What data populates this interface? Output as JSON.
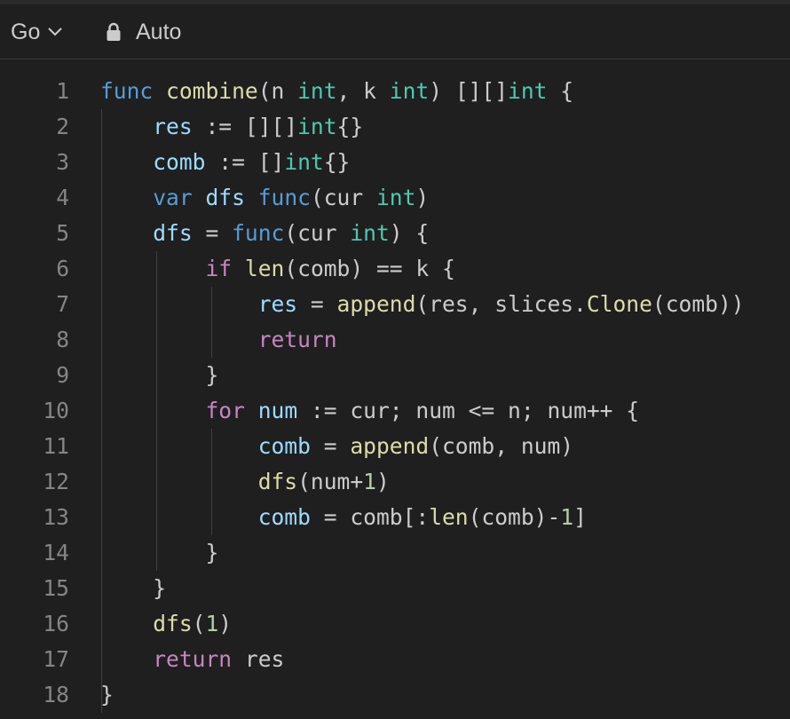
{
  "toolbar": {
    "language": "Go",
    "mode": "Auto",
    "language_dropdown_icon": "chevron-down-icon",
    "mode_icon": "lock-icon"
  },
  "colors": {
    "background": "#1f1f1f",
    "keyword": "#569cd6",
    "control": "#c586c0",
    "function": "#dcdcaa",
    "type": "#4ec9b0",
    "variable": "#9cdcfe",
    "number": "#b5cea8",
    "plain": "#cccccc",
    "line_number": "#858585"
  },
  "code": [
    {
      "n": "1",
      "tokens": [
        [
          "func",
          "kw"
        ],
        [
          " "
        ],
        [
          "combine",
          "fn"
        ],
        [
          "(n "
        ],
        [
          "int",
          "ty"
        ],
        [
          ", k "
        ],
        [
          "int",
          "ty"
        ],
        [
          ") [][]"
        ],
        [
          "int",
          "ty"
        ],
        [
          " {"
        ]
      ]
    },
    {
      "n": "2",
      "tokens": [
        [
          "    "
        ],
        [
          "res",
          "var"
        ],
        [
          " := [][]"
        ],
        [
          "int",
          "ty"
        ],
        [
          "{}"
        ]
      ]
    },
    {
      "n": "3",
      "tokens": [
        [
          "    "
        ],
        [
          "comb",
          "var"
        ],
        [
          " := []"
        ],
        [
          "int",
          "ty"
        ],
        [
          "{}"
        ]
      ]
    },
    {
      "n": "4",
      "tokens": [
        [
          "    "
        ],
        [
          "var",
          "kw"
        ],
        [
          " "
        ],
        [
          "dfs",
          "var"
        ],
        [
          " "
        ],
        [
          "func",
          "kw"
        ],
        [
          "(cur "
        ],
        [
          "int",
          "ty"
        ],
        [
          ")"
        ]
      ]
    },
    {
      "n": "5",
      "tokens": [
        [
          "    "
        ],
        [
          "dfs",
          "var"
        ],
        [
          " = "
        ],
        [
          "func",
          "kw"
        ],
        [
          "(cur "
        ],
        [
          "int",
          "ty"
        ],
        [
          ") {"
        ]
      ]
    },
    {
      "n": "6",
      "tokens": [
        [
          "        "
        ],
        [
          "if",
          "ctl"
        ],
        [
          " "
        ],
        [
          "len",
          "fn"
        ],
        [
          "(comb) == k {"
        ]
      ]
    },
    {
      "n": "7",
      "tokens": [
        [
          "            "
        ],
        [
          "res",
          "var"
        ],
        [
          " = "
        ],
        [
          "append",
          "fn"
        ],
        [
          "(res, slices."
        ],
        [
          "Clone",
          "fn"
        ],
        [
          "(comb))"
        ]
      ]
    },
    {
      "n": "8",
      "tokens": [
        [
          "            "
        ],
        [
          "return",
          "ctl"
        ]
      ]
    },
    {
      "n": "9",
      "tokens": [
        [
          "        }"
        ]
      ]
    },
    {
      "n": "10",
      "tokens": [
        [
          "        "
        ],
        [
          "for",
          "ctl"
        ],
        [
          " "
        ],
        [
          "num",
          "var"
        ],
        [
          " := cur; num <= n; num++ {"
        ]
      ]
    },
    {
      "n": "11",
      "tokens": [
        [
          "            "
        ],
        [
          "comb",
          "var"
        ],
        [
          " = "
        ],
        [
          "append",
          "fn"
        ],
        [
          "(comb, num)"
        ]
      ]
    },
    {
      "n": "12",
      "tokens": [
        [
          "            "
        ],
        [
          "dfs",
          "fn"
        ],
        [
          "(num+"
        ],
        [
          "1",
          "num"
        ],
        [
          ")"
        ]
      ]
    },
    {
      "n": "13",
      "tokens": [
        [
          "            "
        ],
        [
          "comb",
          "var"
        ],
        [
          " = comb[:"
        ],
        [
          "len",
          "fn"
        ],
        [
          "(comb)-"
        ],
        [
          "1",
          "num"
        ],
        [
          "]"
        ]
      ]
    },
    {
      "n": "14",
      "tokens": [
        [
          "        }"
        ]
      ]
    },
    {
      "n": "15",
      "tokens": [
        [
          "    }"
        ]
      ]
    },
    {
      "n": "16",
      "tokens": [
        [
          "    "
        ],
        [
          "dfs",
          "fn"
        ],
        [
          "("
        ],
        [
          "1",
          "num"
        ],
        [
          ")"
        ]
      ]
    },
    {
      "n": "17",
      "tokens": [
        [
          "    "
        ],
        [
          "return",
          "ctl"
        ],
        [
          " res"
        ]
      ]
    },
    {
      "n": "18",
      "tokens": [
        [
          "}"
        ]
      ]
    }
  ]
}
